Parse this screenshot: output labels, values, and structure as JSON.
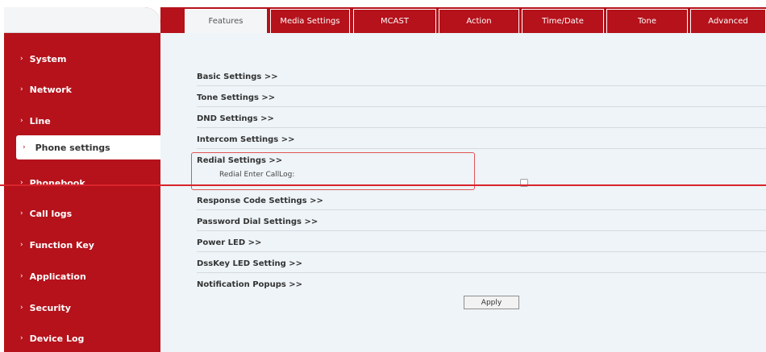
{
  "sidebar": {
    "items": [
      {
        "label": "System"
      },
      {
        "label": "Network"
      },
      {
        "label": "Line"
      },
      {
        "label": "Phone settings"
      },
      {
        "label": "Phonebook"
      },
      {
        "label": "Call logs"
      },
      {
        "label": "Function Key"
      },
      {
        "label": "Application"
      },
      {
        "label": "Security"
      },
      {
        "label": "Device Log"
      }
    ],
    "arrow": "›"
  },
  "tabs": [
    {
      "label": "Features"
    },
    {
      "label": "Media Settings"
    },
    {
      "label": "MCAST"
    },
    {
      "label": "Action"
    },
    {
      "label": "Time/Date"
    },
    {
      "label": "Tone"
    },
    {
      "label": "Advanced"
    }
  ],
  "settings": [
    {
      "label": "Basic Settings >>"
    },
    {
      "label": "Tone Settings >>"
    },
    {
      "label": "DND Settings >>"
    },
    {
      "label": "Intercom Settings >>"
    },
    {
      "label": "Redial Settings >>"
    },
    {
      "label": "Response Code Settings >>"
    },
    {
      "label": "Password Dial Settings >>"
    },
    {
      "label": "Power LED >>"
    },
    {
      "label": "DssKey LED Setting >>"
    },
    {
      "label": "Notification Popups >>"
    }
  ],
  "redial": {
    "field_label": "Redial Enter CallLog:",
    "checked": false
  },
  "apply_label": "Apply",
  "colors": {
    "brand_red": "#b5121b",
    "content_bg": "#eef4f8",
    "highlight_box": "#e25555",
    "overlay_line": "#d9242b"
  }
}
